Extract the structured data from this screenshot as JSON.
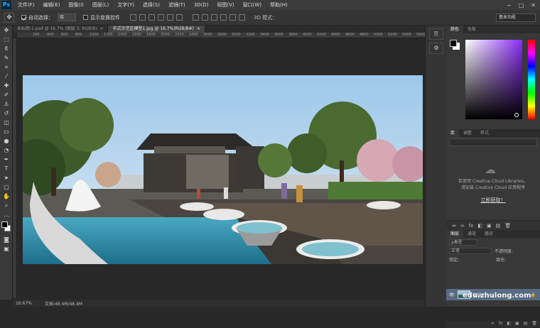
{
  "app": {
    "logo": "Ps"
  },
  "menu": [
    "文件(F)",
    "编辑(E)",
    "图像(I)",
    "图层(L)",
    "文字(Y)",
    "选择(S)",
    "滤镜(T)",
    "3D(D)",
    "视图(V)",
    "窗口(W)",
    "帮助(H)"
  ],
  "window_controls": {
    "minimize": "−",
    "maximize": "□",
    "close": "✕"
  },
  "options": {
    "auto_select_label": "自动选择：",
    "auto_select_value": "组",
    "transform_label": "显示变换控件",
    "mode_3d": "3D 模式：",
    "workspace": "基本功能"
  },
  "tabs": [
    {
      "label": "未标题-1.psd @ 16.7% (图层 3, RGB/8)",
      "close": "×"
    },
    {
      "label": "中式示范区模型1.jpg @ 16.7%(RGB/8#)",
      "close": "×"
    }
  ],
  "ruler_ticks": [
    "200",
    "400",
    "600",
    "800",
    "1000",
    "1200",
    "1400",
    "1600",
    "1800",
    "2000",
    "2200",
    "2400",
    "2600",
    "2800",
    "3000",
    "3200",
    "3400",
    "3600",
    "3800",
    "4000",
    "4200",
    "4400",
    "4600",
    "4800",
    "5000",
    "5200",
    "5400",
    "5600"
  ],
  "status": {
    "zoom": "16.67%",
    "doc": "文档:48.4M/48.4M"
  },
  "panels": {
    "color_tabs": [
      "颜色",
      "色板"
    ],
    "lib_tabs": [
      "库",
      "调整",
      "样式"
    ],
    "lib_message_1": "若使用 Creative Cloud Libraries，",
    "lib_message_2": "请安装 Creative Cloud 应用程序",
    "lib_link": "立即获取！",
    "adj_icons": [
      "⇔",
      "∞",
      "fx",
      "◧",
      "▣",
      "▤",
      "🗑"
    ],
    "layers_tabs": [
      "图层",
      "通道",
      "路径"
    ],
    "kind_label": "ρ类型",
    "blend_mode": "正常",
    "opacity_label": "不透明度:",
    "lock_label": "锁定:",
    "fill_label": "填充:",
    "layer_name": "背景"
  },
  "watermark": "edu.zhulong.com"
}
